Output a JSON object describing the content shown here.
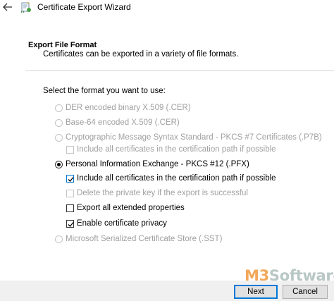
{
  "window": {
    "title": "Certificate Export Wizard",
    "back_icon": "back-arrow-icon",
    "app_icon": "certificate-wizard-icon"
  },
  "header": {
    "title": "Export File Format",
    "subtitle": "Certificates can be exported in a variety of file formats."
  },
  "prompt": "Select the format you want to use:",
  "formats": [
    {
      "label": "DER encoded binary X.509 (.CER)",
      "selected": false,
      "enabled": false
    },
    {
      "label": "Base-64 encoded X.509 (.CER)",
      "selected": false,
      "enabled": false
    },
    {
      "label": "Cryptographic Message Syntax Standard - PKCS #7 Certificates (.P7B)",
      "selected": false,
      "enabled": false
    },
    {
      "label": "Personal Information Exchange - PKCS #12 (.PFX)",
      "selected": true,
      "enabled": true
    },
    {
      "label": "Microsoft Serialized Certificate Store (.SST)",
      "selected": false,
      "enabled": false
    }
  ],
  "p7b_options": [
    {
      "label": "Include all certificates in the certification path if possible",
      "checked": false,
      "enabled": false
    }
  ],
  "pfx_options": [
    {
      "label": "Include all certificates in the certification path if possible",
      "checked": true,
      "enabled": true
    },
    {
      "label": "Delete the private key if the export is successful",
      "checked": false,
      "enabled": false
    },
    {
      "label": "Export all extended properties",
      "checked": false,
      "enabled": true
    },
    {
      "label": "Enable certificate privacy",
      "checked": true,
      "enabled": true
    }
  ],
  "watermark": {
    "brand": "M3",
    "rest": "Software"
  },
  "buttons": {
    "next": "Next",
    "cancel": "Cancel"
  },
  "colors": {
    "accent": "#0078d7",
    "disabled_text": "#a0a0a0",
    "footer_bg": "#f0f0f0",
    "watermark_brand": "#f2a85a",
    "watermark_text": "#b9c7c5"
  }
}
